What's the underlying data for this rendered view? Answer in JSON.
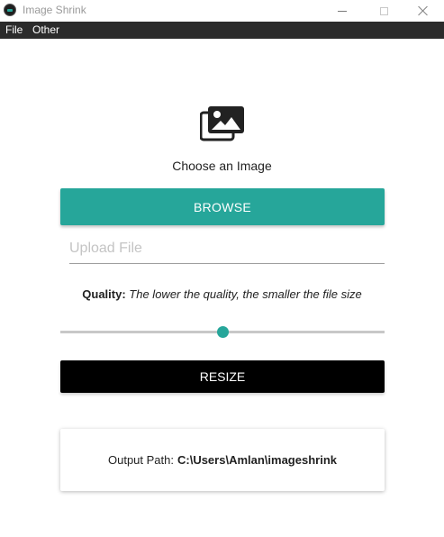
{
  "window": {
    "title": "Image Shrink",
    "buttons": [
      "minimize",
      "maximize",
      "close"
    ]
  },
  "menubar": {
    "items": [
      "File",
      "Other"
    ]
  },
  "main": {
    "icon": "images-icon",
    "choose_text": "Choose an Image",
    "browse_label": "BROWSE",
    "upload_placeholder": "Upload File",
    "upload_value": "",
    "quality_label": "Quality:",
    "quality_desc": "The lower the quality, the smaller the file size",
    "slider_value_percent": 50,
    "resize_label": "RESIZE",
    "output_label": "Output Path:",
    "output_path": "C:\\Users\\Amlan\\imageshrink"
  },
  "colors": {
    "accent": "#26a69a",
    "menubar_bg": "#2b2b2b",
    "resize_bg": "#000000"
  }
}
